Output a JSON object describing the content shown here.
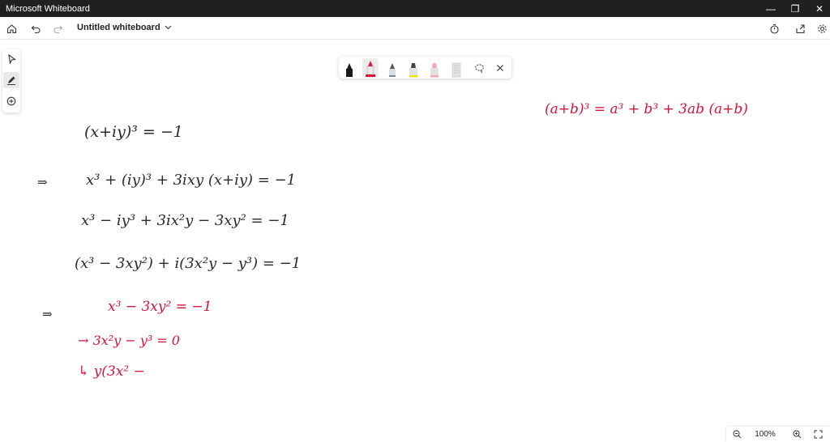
{
  "app": {
    "title": "Microsoft Whiteboard"
  },
  "window_controls": {
    "minimize": "—",
    "restore": "❐",
    "close": "✕"
  },
  "toolbar": {
    "document_name": "Untitled whiteboard"
  },
  "left_tools": [
    "select-tool",
    "pen-tool",
    "add-tool"
  ],
  "pen_tray": {
    "pens": [
      {
        "name": "black-pen",
        "color": "#1a1a1a"
      },
      {
        "name": "red-pen",
        "color": "#d5143a",
        "selected": true
      },
      {
        "name": "gray-blue-pen",
        "color": "#6f8aa8"
      },
      {
        "name": "yellow-highlighter",
        "color": "#f2e400"
      },
      {
        "name": "pink-highlighter",
        "color": "#f4a7b3"
      },
      {
        "name": "ruler",
        "color": "#bdbdbd"
      }
    ],
    "lasso_icon": "lasso-icon",
    "close_icon": "close-icon"
  },
  "whiteboard": {
    "ink_lines": [
      {
        "text": "(x+iy)³ = −1",
        "color": "black"
      },
      {
        "text": "⇒",
        "color": "black"
      },
      {
        "text": "x³ + (iy)³ + 3ixy (x+iy) = −1",
        "color": "black"
      },
      {
        "text": "x³ − iy³ + 3ix²y − 3xy² = −1",
        "color": "black"
      },
      {
        "text": "(x³ − 3xy²) + i(3x²y − y³) = −1",
        "color": "black"
      },
      {
        "text": "⇒",
        "color": "black"
      },
      {
        "text": "x³ − 3xy² = −1",
        "color": "red"
      },
      {
        "text": "→ 3x²y − y³ = 0",
        "color": "red"
      },
      {
        "text": "↳ y(3x² − ",
        "color": "red"
      },
      {
        "text": "(a+b)³ = a³ + b³ + 3ab (a+b)",
        "color": "red"
      }
    ]
  },
  "zoom": {
    "level": "100%",
    "zoom_out_icon": "zoom-out-icon",
    "zoom_in_icon": "zoom-in-icon",
    "fit_icon": "fit-screen-icon"
  }
}
